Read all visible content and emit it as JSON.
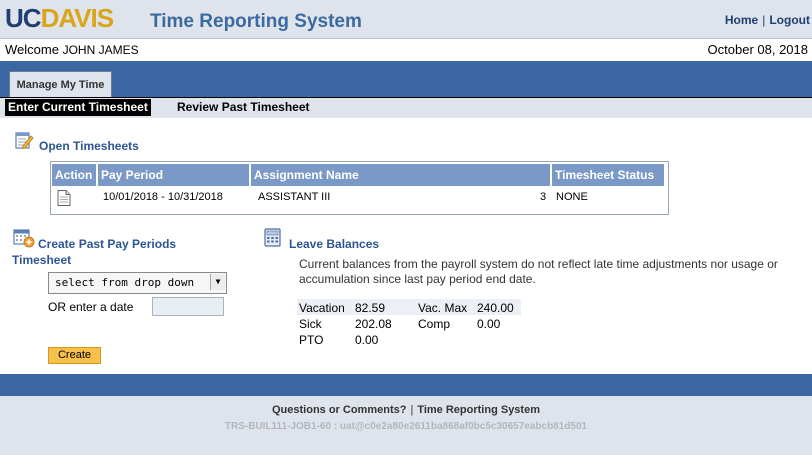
{
  "header": {
    "logo_uc": "UC",
    "logo_davis": "DAVIS",
    "app_title": "Time Reporting System",
    "home_link": "Home",
    "link_separator": "|",
    "logout_link": "Logout"
  },
  "welcome": {
    "label": "Welcome",
    "user_name": "JOHN JAMES",
    "date": "October 08, 2018"
  },
  "tabs": [
    {
      "label": "Manage My Time",
      "active": true
    }
  ],
  "subnav": {
    "current": "Enter Current Timesheet",
    "past": "Review Past Timesheet"
  },
  "open_timesheets": {
    "title": "Open Timesheets",
    "icon": "notepad-pencil-icon",
    "columns": [
      "Action",
      "Pay Period",
      "Assignment Name",
      "Timesheet Status"
    ],
    "rows": [
      {
        "action_icon": "document-icon",
        "pay_period": "10/01/2018 - 10/31/2018",
        "assignment_name": "ASSISTANT III",
        "assignment_number": "3",
        "status": "NONE"
      }
    ]
  },
  "create_past": {
    "title_line1": "Create Past Pay Periods",
    "title_line2": "Timesheet",
    "icon": "calendar-add-icon",
    "select_value": "select from drop down",
    "or_label": "OR enter a date",
    "date_value": "",
    "create_button": "Create"
  },
  "leave_balances": {
    "title": "Leave Balances",
    "icon": "calculator-icon",
    "note": "Current balances from the payroll system do not reflect late time adjustments nor usage or accumulation since last pay period end date.",
    "rows": [
      {
        "label": "Vacation",
        "value": "82.59",
        "label2": "Vac. Max",
        "value2": "240.00"
      },
      {
        "label": "Sick",
        "value": "202.08",
        "label2": "Comp",
        "value2": "0.00"
      },
      {
        "label": "PTO",
        "value": "0.00",
        "label2": "",
        "value2": ""
      }
    ]
  },
  "footer": {
    "questions_link": "Questions or Comments?",
    "separator": "|",
    "trs_link": "Time Reporting System",
    "build_info": "TRS-BUIL111-JOB1-60 : uat@c0e2a80e2611ba868af0bc5c30657eabcb81d501"
  },
  "colors": {
    "brand_navy": "#1f3f73",
    "brand_gold": "#d9a51b",
    "band_blue": "#3a66a1",
    "table_header_blue": "#7b99c6",
    "section_title_blue": "#2c5592",
    "button_gold": "#f7c04a"
  }
}
